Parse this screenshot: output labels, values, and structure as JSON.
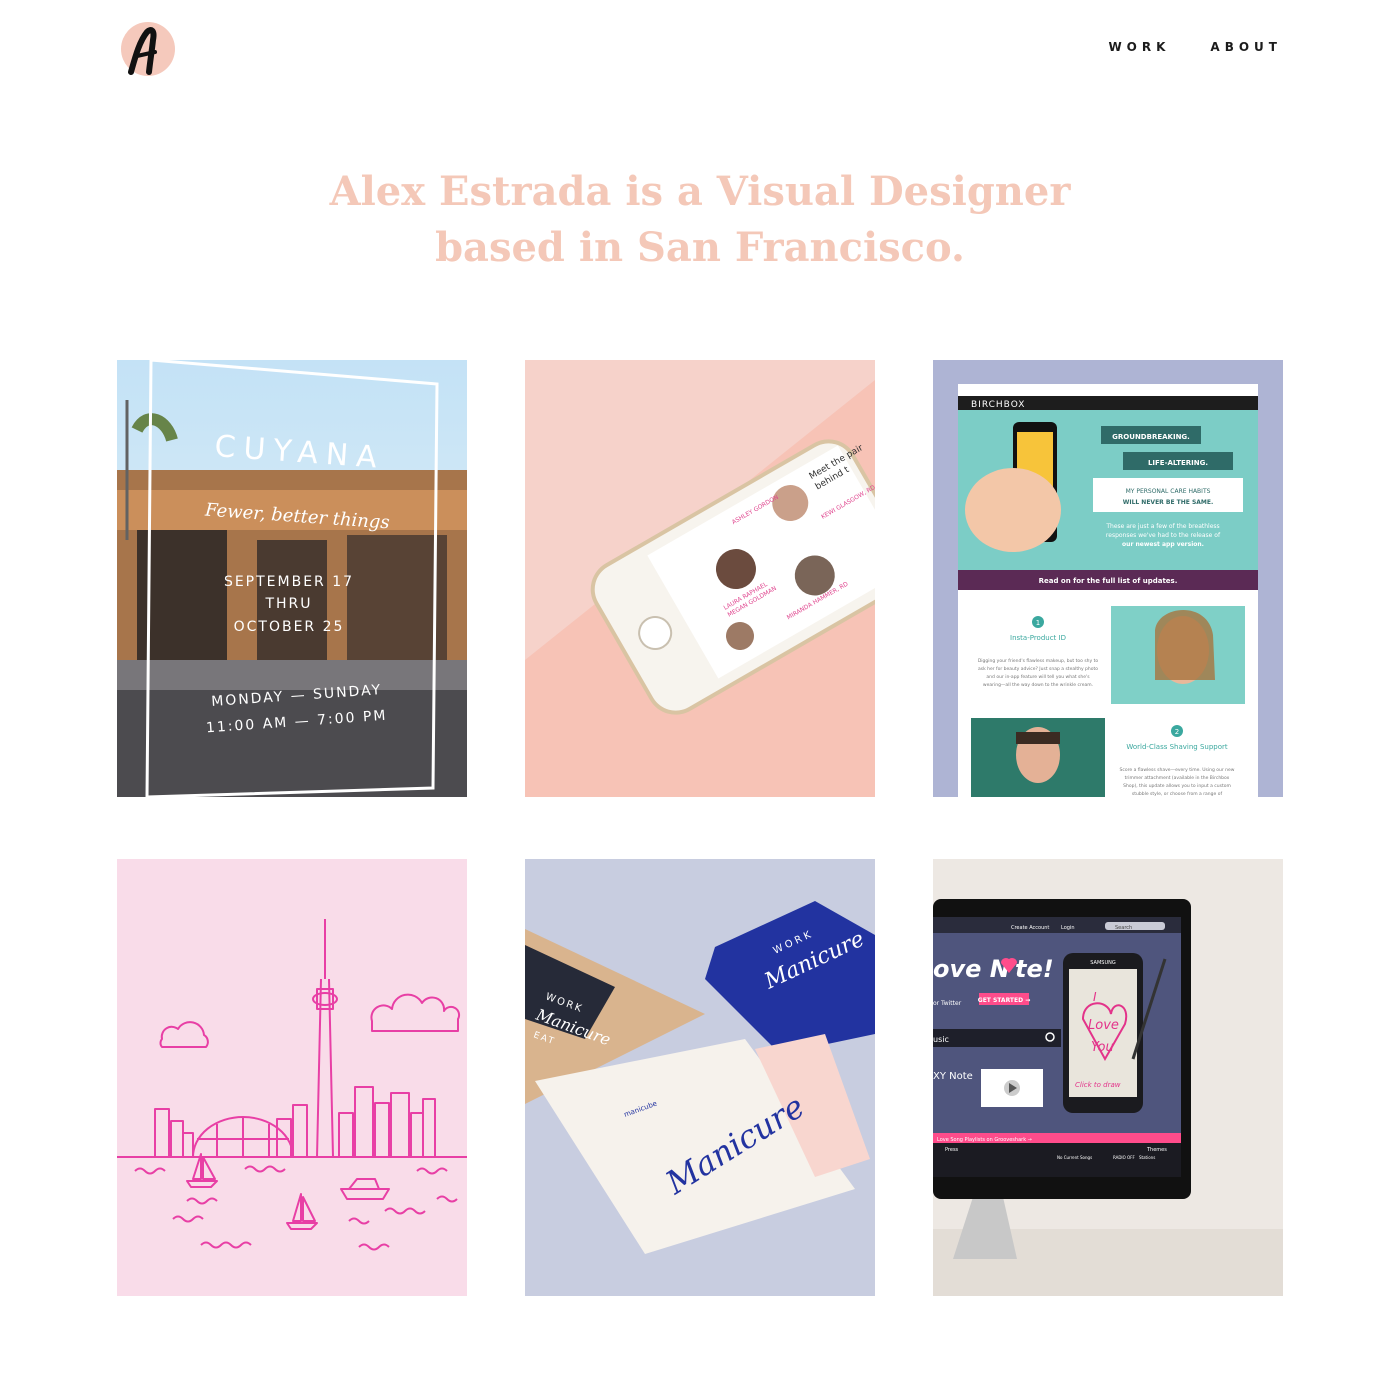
{
  "nav": {
    "work": "WORK",
    "about": "ABOUT"
  },
  "hero": {
    "line1": "Alex Estrada is a Visual Designer",
    "line2": "based in San Francisco."
  },
  "colors": {
    "accent": "#f4c8b8",
    "logo_circle": "#f5c9bc",
    "nav_text": "#1c1c1c",
    "toronto_pink": "#e83fa5",
    "birchbox_teal": "#7ccdc6",
    "birchbox_purple": "#5b2a55"
  },
  "projects": [
    {
      "id": "cuyana",
      "brand": "CUYANA",
      "tagline": "Fewer, better things",
      "dates": [
        "SEPTEMBER 17",
        "THRU",
        "OCTOBER 25"
      ],
      "days": "MONDAY — SUNDAY",
      "hours": "11:00 AM — 7:00 PM"
    },
    {
      "id": "phone-app",
      "screen_texts": [
        "Meet the pair",
        "behind t",
        "ASHLEY GORDON",
        "LAURA RAPHAEL",
        "MEGAN GOLDMAN",
        "KEWI GLASGOW, RD",
        "MIRANDA HAMMER, RD"
      ]
    },
    {
      "id": "birchbox",
      "brand": "BIRCHBOX",
      "quote1": "GROUNDBREAKING.",
      "quote2": "LIFE-ALTERING.",
      "quote3a": "MY PERSONAL CARE HABITS",
      "quote3b": "WILL NEVER BE THE SAME.",
      "intro1": "These are just a few of the breathless",
      "intro2": "responses we've had to the release of",
      "intro3": "our newest app version.",
      "banner": "Read on for the full list of updates.",
      "feature1_num": "1",
      "feature1_title": "Insta-Product ID",
      "feature1_lines": [
        "Digging your friend's flawless makeup, but too shy to",
        "ask her for beauty advice? Just snap a stealthy photo",
        "and our in-app feature will tell you what she's",
        "wearing—all the way down to the wrinkle cream."
      ],
      "feature2_num": "2",
      "feature2_title": "World-Class Shaving Support",
      "feature2_lines": [
        "Score a flawless shave—every time. Using our new",
        "trimmer attachment (available in the Birchbox",
        "Shop), this update allows you to input a custom",
        "stubble style, or choose from a range of"
      ]
    },
    {
      "id": "toronto-skyline"
    },
    {
      "id": "manicure",
      "pouch_text": "WORK",
      "script": "Manicure",
      "small_brand": "manicube",
      "book_text": "WORK",
      "book_script": "Manicure",
      "book_sub": "EAT"
    },
    {
      "id": "love-note",
      "nav_items": [
        "Create Account",
        "Login",
        "Search"
      ],
      "headline": "ove N",
      "headline_end": "te!",
      "twitter_text": "or Twitter",
      "cta": "GET STARTED →",
      "search_label": "usic",
      "product": "XY Note",
      "handwriting1": "I",
      "handwriting2": "Love",
      "handwriting3": "You",
      "click_to_draw": "Click to draw",
      "phone_brand": "SAMSUNG",
      "playlist": "Love Song Playlists on Grooveshark →",
      "bar_items": [
        "Press",
        "Themes"
      ],
      "player_items": [
        "No Current Songs",
        "RADIO OFF",
        "Stations"
      ]
    }
  ]
}
